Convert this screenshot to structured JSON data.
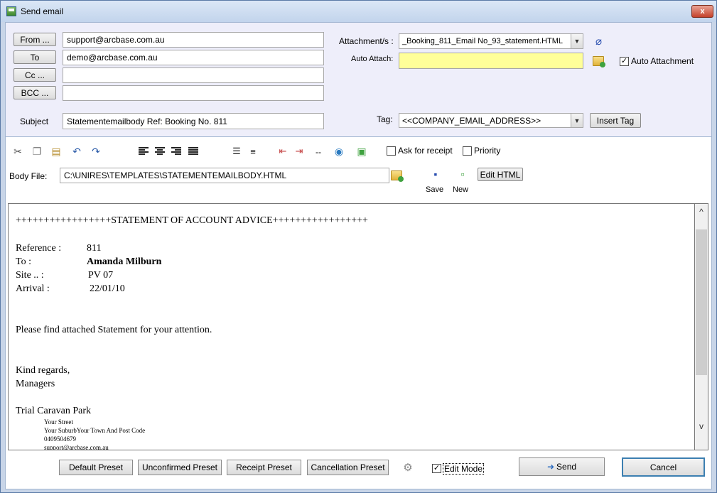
{
  "window": {
    "title": "Send email",
    "close_glyph": "x"
  },
  "recipients": {
    "from_button": "From ...",
    "from_value": "support@arcbase.com.au",
    "to_button": "To",
    "to_value": "demo@arcbase.com.au",
    "cc_button": "Cc ...",
    "cc_value": "",
    "bcc_button": "BCC ...",
    "bcc_value": "",
    "subject_label": "Subject",
    "subject_value": "Statementemailbody Ref: Booking No. 811"
  },
  "attachments": {
    "label": "Attachment/s :",
    "value": "_Booking_811_Email No_93_statement.HTML",
    "auto_attach_label": "Auto Attach:",
    "auto_attach_value": "",
    "auto_attachment_checkbox_label": "Auto Attachment",
    "auto_attachment_checked": true,
    "highlight_color": "#ffff99"
  },
  "tag": {
    "label": "Tag:",
    "value": "<<COMPANY_EMAIL_ADDRESS>>",
    "insert_button": "Insert Tag"
  },
  "toolbar": {
    "ask_receipt_label": "Ask for receipt",
    "ask_receipt_checked": false,
    "priority_label": "Priority",
    "priority_checked": false,
    "hr_glyph": "--"
  },
  "body_file": {
    "label": "Body File:",
    "value": "C:\\UNIRES\\TEMPLATES\\STATEMENTEMAILBODY.HTML",
    "save_label": "Save",
    "new_label": "New",
    "edit_html_button": "Edit HTML"
  },
  "document": {
    "heading": "+++++++++++++++++STATEMENT OF ACCOUNT ADVICE+++++++++++++++++",
    "reference_label": "Reference :",
    "reference_value": "811",
    "to_label": "To       :",
    "to_value": "Amanda Milburn",
    "site_label": "Site ..   :",
    "site_value": "PV 07",
    "arrival_label": "Arrival   :",
    "arrival_value": "22/01/10",
    "message": "Please find attached Statement for your attention.",
    "regards": "Kind regards,",
    "signoff": "Managers",
    "company": "Trial Caravan Park",
    "address_1": "Your Street",
    "address_2": "Your SuburbYour Town And Post Code",
    "phone": "0409504679",
    "email": "support@arcbase.com.au"
  },
  "footer": {
    "default_preset": "Default Preset",
    "unconfirmed_preset": "Unconfirmed Preset",
    "receipt_preset": "Receipt Preset",
    "cancellation_preset": "Cancellation Preset",
    "edit_mode_label": "Edit Mode",
    "edit_mode_checked": true,
    "send_button": "Send",
    "cancel_button": "Cancel"
  }
}
